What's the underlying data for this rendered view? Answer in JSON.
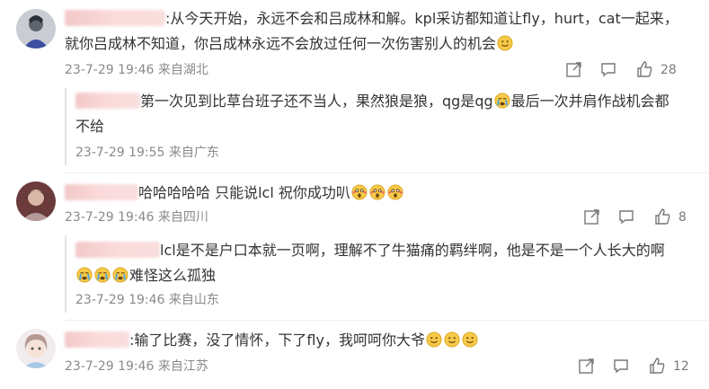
{
  "comments": [
    {
      "text_line1": ":从今天开始，永远不会和吕成林和解。kpl采访都知道让fly，hurt，cat一起来，",
      "text_line2": "就你吕成林不知道，你吕成林永远不会放过任何一次伤害别人的机会",
      "meta": "23-7-29 19:46 来自湖北",
      "likes": "28",
      "reply": {
        "text_line1": "第一次见到比草台班子还不当人，果然狼是狼，qg是qg",
        "text_line1_tail": "最后一次并肩作战机会都",
        "text_line2": "不给",
        "meta": "23-7-29 19:55 来自广东"
      }
    },
    {
      "text_line1": "哈哈哈哈哈 只能说lcl 祝你成功叭",
      "meta": "23-7-29 19:46 来自四川",
      "likes": "8",
      "reply": {
        "text_line1": "lcl是不是户口本就一页啊，理解不了牛猫痛的羁绊啊，他是不是一个人长大的啊",
        "text_line2": "难怪这么孤独",
        "meta": "23-7-29 19:46 来自山东"
      }
    },
    {
      "text_line1": ":输了比赛，没了情怀，下了fly，我呵呵你大爷",
      "meta": "23-7-29 19:46 来自江苏",
      "likes": "12"
    }
  ],
  "icons": {
    "share": "share-icon",
    "comment": "comment-icon",
    "like": "thumbs-up-icon",
    "emoji_smile": "smile-emoji-icon",
    "emoji_cry": "crying-emoji-icon",
    "emoji_scream": "scream-emoji-icon"
  },
  "colors": {
    "text": "#333333",
    "meta": "#8a8a8a",
    "redaction": "#f3c6c6"
  }
}
